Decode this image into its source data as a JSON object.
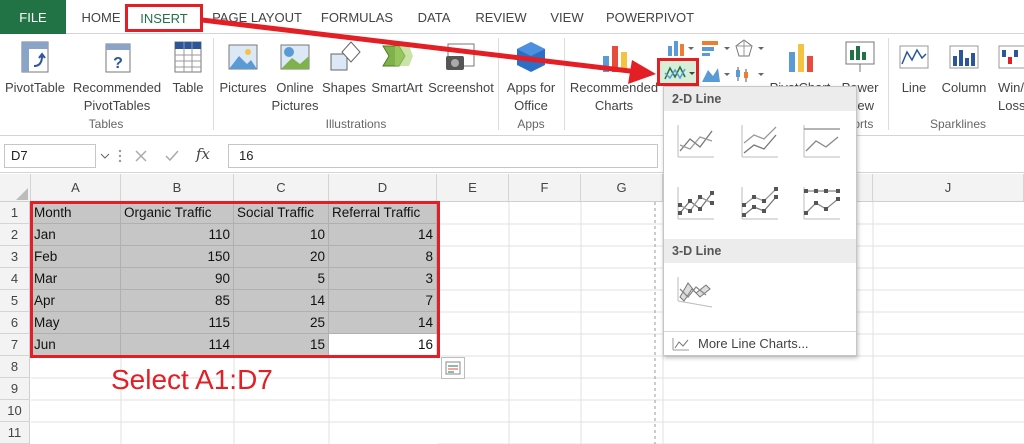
{
  "tabs": [
    {
      "label": "FILE",
      "name": "tab-file"
    },
    {
      "label": "HOME",
      "name": "tab-home"
    },
    {
      "label": "INSERT",
      "name": "tab-insert"
    },
    {
      "label": "PAGE LAYOUT",
      "name": "tab-page-layout"
    },
    {
      "label": "FORMULAS",
      "name": "tab-formulas"
    },
    {
      "label": "DATA",
      "name": "tab-data"
    },
    {
      "label": "REVIEW",
      "name": "tab-review"
    },
    {
      "label": "VIEW",
      "name": "tab-view"
    },
    {
      "label": "POWERPIVOT",
      "name": "tab-powerpivot"
    }
  ],
  "ribbon": {
    "pivottable": "PivotTable",
    "recommended_pivottables_1": "Recommended",
    "recommended_pivottables_2": "PivotTables",
    "table": "Table",
    "group_tables": "Tables",
    "pictures": "Pictures",
    "online_pictures_1": "Online",
    "online_pictures_2": "Pictures",
    "shapes": "Shapes",
    "smartart": "SmartArt",
    "screenshot": "Screenshot",
    "group_illustrations": "Illustrations",
    "apps_for_office_1": "Apps for",
    "apps_for_office_2": "Office",
    "group_apps": "Apps",
    "recommended_charts_1": "Recommended",
    "recommended_charts_2": "Charts",
    "pivotchart": "PivotChart",
    "power_view_1": "Power",
    "power_view_2": "View",
    "group_reports": "ports",
    "line": "Line",
    "column": "Column",
    "winloss_1": "Win/",
    "winloss_2": "Loss",
    "group_sparklines": "Sparklines"
  },
  "formula_bar": {
    "name_box": "D7",
    "value": "16",
    "fx": "fx"
  },
  "columns": [
    "A",
    "B",
    "C",
    "D",
    "E",
    "F",
    "G",
    "J"
  ],
  "rows": [
    "1",
    "2",
    "3",
    "4",
    "5",
    "6",
    "7",
    "8",
    "9",
    "10",
    "11"
  ],
  "table": {
    "headers": [
      "Month",
      "Organic Traffic",
      "Social Traffic",
      "Referral Traffic"
    ],
    "rows": [
      [
        "Jan",
        "110",
        "10",
        "14"
      ],
      [
        "Feb",
        "150",
        "20",
        "8"
      ],
      [
        "Mar",
        "90",
        "5",
        "3"
      ],
      [
        "Apr",
        "85",
        "14",
        "7"
      ],
      [
        "May",
        "115",
        "25",
        "14"
      ],
      [
        "Jun",
        "114",
        "15",
        "16"
      ]
    ]
  },
  "dropdown": {
    "header_2d": "2-D Line",
    "header_3d": "3-D Line",
    "more": "More Line Charts..."
  },
  "annotation": "Select A1:D7",
  "colors": {
    "excel_green": "#217346",
    "highlight_red": "#e31e24",
    "selection_gray": "#c6c6c6"
  }
}
